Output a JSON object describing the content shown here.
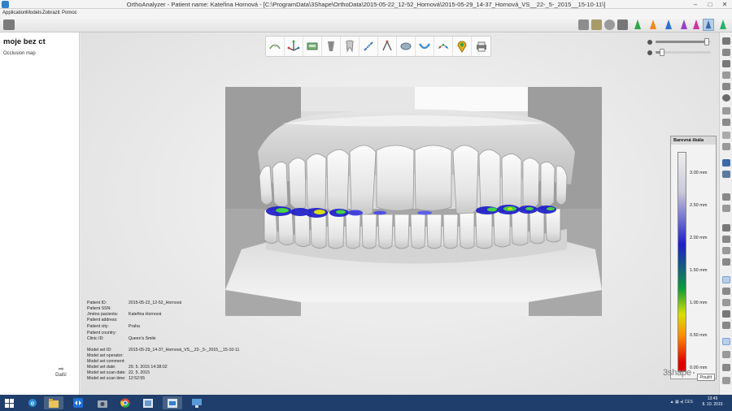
{
  "window": {
    "title": "OrthoAnalyzer - Patient name: Kateřina Hornová - [C:\\ProgramData\\3Shape\\OrthoData\\2015-05-22_12-52_Hornová\\2015-05-29_14-37_Hornová_VS__22-_5-_2015__15-10-11\\]",
    "min": "–",
    "max": "□",
    "close": "✕"
  },
  "menu": [
    "Application",
    "Models",
    "Zobrazit",
    "Pomoc"
  ],
  "left_panel": {
    "title": "moje bez ct",
    "subtitle": "Occlusion map",
    "next_label": "Další"
  },
  "patient_info": [
    {
      "label": "Patient ID:",
      "value": "2015-05-22_12-52_Hornová"
    },
    {
      "label": "Patient SSN:",
      "value": ""
    },
    {
      "label": "Jméno pacienta:",
      "value": "Kateřina Hornová"
    },
    {
      "label": "Patient address:",
      "value": ""
    },
    {
      "label": "Patient city:",
      "value": "Praha"
    },
    {
      "label": "Patient country:",
      "value": ""
    },
    {
      "label": "Clinic ID:",
      "value": "Queen's Smile"
    }
  ],
  "model_info": [
    {
      "label": "Model set ID:",
      "value": "2015-05-29_14-37_Hornová_VS__22-_5-_2015__15-10-11"
    },
    {
      "label": "Model set operator:",
      "value": ""
    },
    {
      "label": "Model set comment:",
      "value": ""
    },
    {
      "label": "Model set date:",
      "value": "29. 5. 2015 14:38:02"
    },
    {
      "label": "Model set scan date:",
      "value": "22. 5. 2015"
    },
    {
      "label": "Model set scan time:",
      "value": "12:52:55"
    }
  ],
  "color_scale": {
    "title": "Barevná škála",
    "labels": [
      "3.00 mm",
      "2.50 mm",
      "2.00 mm",
      "1.50 mm",
      "1.00 mm",
      "0.50 mm",
      "0.00 mm"
    ],
    "apply": "Použít"
  },
  "logo": "3shape",
  "sliders": {
    "top_level": 0.92,
    "bottom_level": 0.12
  },
  "tray": {
    "lang": "CES",
    "time": "13:49",
    "date": "8. 10. 2015"
  },
  "colors": {
    "accent": "#2f7fc9",
    "taskbar": "#1f3e6b",
    "occlusion_green": "#3ad23a",
    "occlusion_blue": "#1e1ec8"
  }
}
